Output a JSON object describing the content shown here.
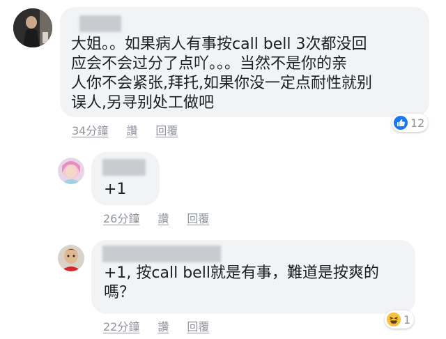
{
  "comments": [
    {
      "text": "大姐。。如果病人有事按call bell 3次都没回\n应会不会过分了点吖。。。当然不是你的亲\n人你不会紧张,拜托,如果你没一定点耐性就别\n误人,另寻别处工做吧",
      "time": "34分鐘",
      "like": "讚",
      "reply": "回覆",
      "reaction_count": "12",
      "reaction_icon": "thumbs-up-icon"
    },
    {
      "text": "+1",
      "time": "26分鐘",
      "like": "讚",
      "reply": "回覆"
    },
    {
      "text": "+1, 按call bell就是有事，難道是按爽的\n嗎？",
      "time": "22分鐘",
      "like": "讚",
      "reply": "回覆",
      "reaction_count": "1",
      "reaction_icon": "laughing-emoji-icon"
    }
  ],
  "colors": {
    "bubble": "#f2f3f5",
    "meta_text": "#90949c",
    "like_blue": "#1877f2",
    "haha_yellow": "#f7c33d"
  }
}
